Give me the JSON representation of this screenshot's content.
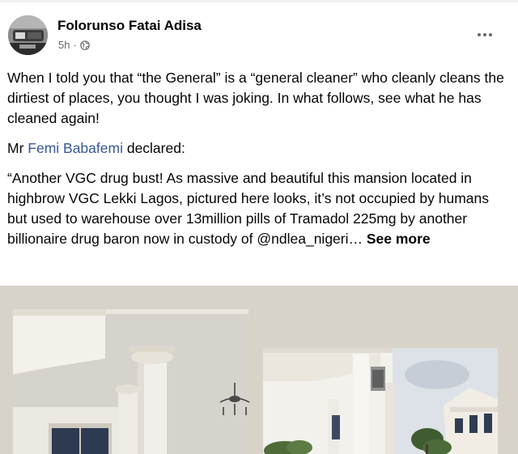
{
  "post": {
    "author": "Folorunso Fatai Adisa",
    "time": "5h",
    "separator": "·",
    "privacy_icon": "globe-icon",
    "menu_icon": "more-options-icon",
    "paragraph1": "When I told you that “the General” is a “general cleaner” who cleanly cleans the dirtiest of places, you thought I was joking. In what follows, see what he has cleaned again!",
    "p2_prefix": "Mr ",
    "p2_mention": "Femi Babafemi",
    "p2_suffix": " declared:",
    "paragraph3": "“Another VGC drug bust! As massive and beautiful this mansion located in highbrow VGC Lekki Lagos, pictured here looks, it’s not occupied by humans but used to warehouse over 13million pills of Tramadol 225mg by another billionaire drug baron now in custody of @ndlea_nigeri…",
    "see_more": "See more"
  },
  "colors": {
    "text": "#050505",
    "secondary": "#65676b",
    "link": "#385898",
    "media_background": "#d8d3c9"
  }
}
